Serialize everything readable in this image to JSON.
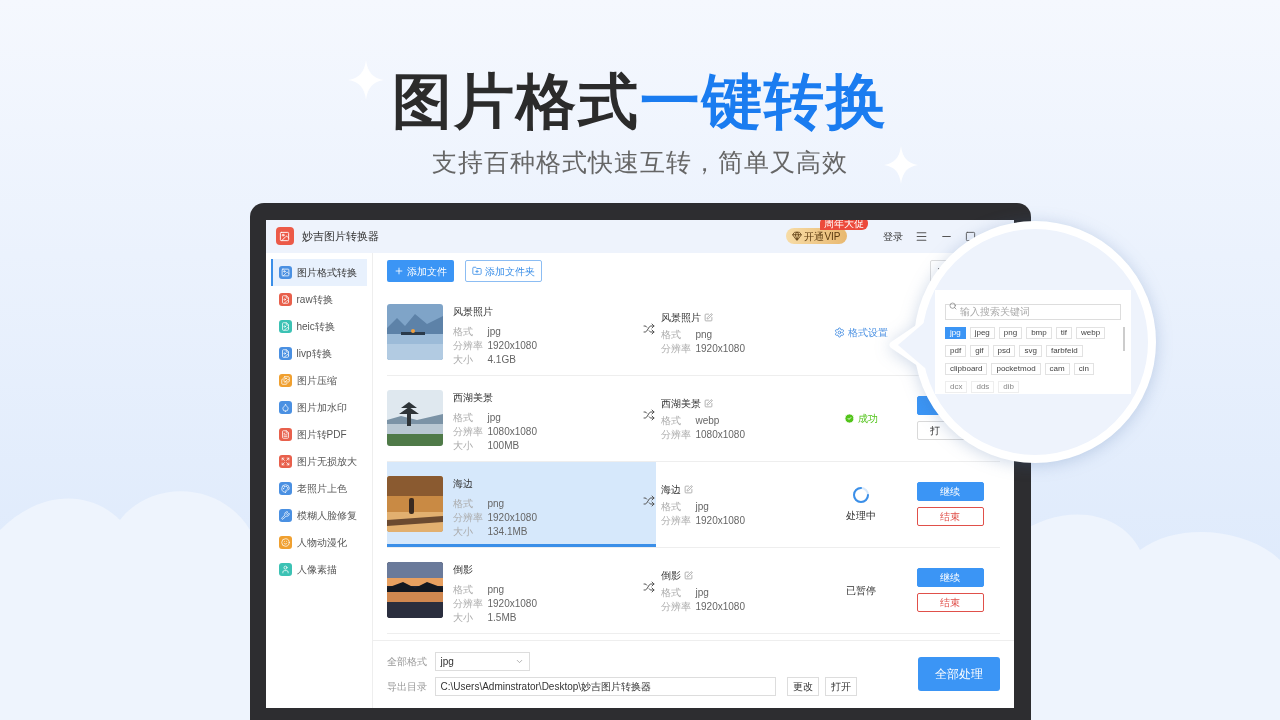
{
  "hero": {
    "title_dark": "图片格式",
    "title_accent": "一键转换",
    "subtitle": "支持百种格式快速互转，简单又高效"
  },
  "app": {
    "name": "妙吉图片转换器",
    "vip_label": "开通VIP",
    "vip_badge": "周年大促",
    "login": "登录"
  },
  "sidebar": [
    {
      "label": "图片格式转换",
      "selected": true,
      "color": "#4a90e2"
    },
    {
      "label": "raw转换",
      "selected": false,
      "color": "#e8604c"
    },
    {
      "label": "heic转换",
      "selected": false,
      "color": "#3cc2b4"
    },
    {
      "label": "livp转换",
      "selected": false,
      "color": "#4a90e2"
    },
    {
      "label": "图片压缩",
      "selected": false,
      "color": "#f0a030"
    },
    {
      "label": "图片加水印",
      "selected": false,
      "color": "#4a90e2"
    },
    {
      "label": "图片转PDF",
      "selected": false,
      "color": "#e8604c"
    },
    {
      "label": "图片无损放大",
      "selected": false,
      "color": "#e8604c"
    },
    {
      "label": "老照片上色",
      "selected": false,
      "color": "#4a90e2"
    },
    {
      "label": "模糊人脸修复",
      "selected": false,
      "color": "#4a90e2"
    },
    {
      "label": "人物动漫化",
      "selected": false,
      "color": "#f0a030"
    },
    {
      "label": "人像素描",
      "selected": false,
      "color": "#3cc2b4"
    }
  ],
  "toolbar": {
    "add_file": "添加文件",
    "add_folder": "添加文件夹"
  },
  "files": [
    {
      "name": "风景照片",
      "fields": [
        {
          "label": "格式",
          "value": "jpg"
        },
        {
          "label": "分辨率",
          "value": "1920x1080"
        },
        {
          "label": "大小",
          "value": "4.1GB"
        }
      ],
      "target_name": "风景照片",
      "target_fields": [
        {
          "label": "格式",
          "value": "png"
        },
        {
          "label": "分辨率",
          "value": "1920x1080"
        }
      ],
      "status": {
        "kind": "settings",
        "text": "格式设置"
      }
    },
    {
      "name": "西湖美景",
      "fields": [
        {
          "label": "格式",
          "value": "jpg"
        },
        {
          "label": "分辨率",
          "value": "1080x1080"
        },
        {
          "label": "大小",
          "value": "100MB"
        }
      ],
      "target_name": "西湖美景",
      "target_fields": [
        {
          "label": "格式",
          "value": "webp"
        },
        {
          "label": "分辨率",
          "value": "1080x1080"
        }
      ],
      "status": {
        "kind": "success",
        "text": "成功"
      },
      "buttons": [
        {
          "kind": "primary"
        },
        {
          "kind": "outline",
          "text": "打"
        }
      ]
    },
    {
      "name": "海边",
      "fields": [
        {
          "label": "格式",
          "value": "png"
        },
        {
          "label": "分辨率",
          "value": "1920x1080"
        },
        {
          "label": "大小",
          "value": "134.1MB"
        }
      ],
      "target_name": "海边",
      "target_fields": [
        {
          "label": "格式",
          "value": "jpg"
        },
        {
          "label": "分辨率",
          "value": "1920x1080"
        }
      ],
      "status": {
        "kind": "processing",
        "text": "处理中"
      },
      "level": 0.44,
      "buttons": [
        {
          "kind": "primary",
          "text": "继续"
        },
        {
          "kind": "danger",
          "text": "结束"
        }
      ]
    },
    {
      "name": "倒影",
      "fields": [
        {
          "label": "格式",
          "value": "png"
        },
        {
          "label": "分辨率",
          "value": "1920x1080"
        },
        {
          "label": "大小",
          "value": "1.5MB"
        }
      ],
      "target_name": "倒影",
      "target_fields": [
        {
          "label": "格式",
          "value": "jpg"
        },
        {
          "label": "分辨率",
          "value": "1920x1080"
        }
      ],
      "status": {
        "kind": "paused",
        "text": "已暂停"
      },
      "buttons": [
        {
          "kind": "primary",
          "text": "继续"
        },
        {
          "kind": "danger",
          "text": "结束"
        }
      ]
    }
  ],
  "bottom": {
    "format_label": "全部格式",
    "format_value": "jpg",
    "dir_label": "导出目录",
    "dir_value": "C:\\Users\\Adminstrator\\Desktop\\妙吉图片转换器",
    "change": "更改",
    "open": "打开",
    "process_all": "全部处理"
  },
  "format_picker": {
    "placeholder": "输入搜索关键词",
    "formats": [
      {
        "label": "jpg",
        "selected": true
      },
      {
        "label": "jpeg",
        "selected": false
      },
      {
        "label": "png",
        "selected": false
      },
      {
        "label": "bmp",
        "selected": false
      },
      {
        "label": "tif",
        "selected": false
      },
      {
        "label": "webp",
        "selected": false
      },
      {
        "label": "pdf",
        "selected": false
      },
      {
        "label": "gif",
        "selected": false
      },
      {
        "label": "psd",
        "selected": false
      },
      {
        "label": "svg",
        "selected": false
      },
      {
        "label": "farbfeid",
        "selected": false
      },
      {
        "label": "clipboard",
        "selected": false
      },
      {
        "label": "pocketmod",
        "selected": false
      },
      {
        "label": "cam",
        "selected": false
      },
      {
        "label": "cin",
        "selected": false
      },
      {
        "label": "dcx",
        "selected": false,
        "dimmed": true
      },
      {
        "label": "dds",
        "selected": false,
        "dimmed": true
      },
      {
        "label": "dib",
        "selected": false,
        "dimmed": true
      }
    ]
  }
}
